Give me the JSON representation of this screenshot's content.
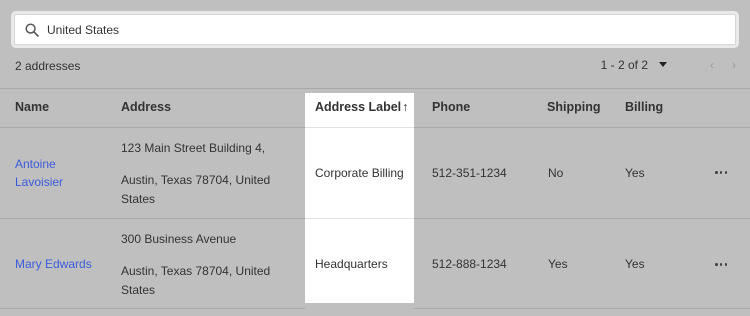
{
  "search": {
    "value": "United States"
  },
  "summary": {
    "count": "2 addresses"
  },
  "pager": {
    "range": "1 - 2 of 2",
    "prev": "‹",
    "next": "›"
  },
  "columns": {
    "name": "Name",
    "address": "Address",
    "label": "Address Label",
    "sort_indicator": "↑",
    "phone": "Phone",
    "shipping": "Shipping",
    "billing": "Billing"
  },
  "rows": [
    {
      "name_line1": "Antoine",
      "name_line2": "Lavoisier",
      "address_line1": "123 Main Street Building 4,",
      "address_line2": "Austin, Texas 78704, United",
      "address_line3": "States",
      "label": "Corporate Billing",
      "phone": "512-351-1234",
      "shipping": "No",
      "billing": "Yes"
    },
    {
      "name_line1": "Mary Edwards",
      "address_line1": "300 Business Avenue",
      "address_line2": "Austin, Texas 78704, United",
      "address_line3": "States",
      "label": "Headquarters",
      "phone": "512-888-1234",
      "shipping": "Yes",
      "billing": "Yes"
    }
  ]
}
